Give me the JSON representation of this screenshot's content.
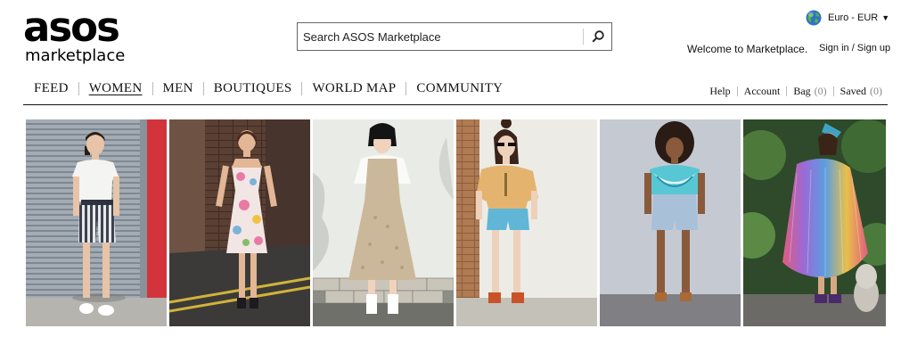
{
  "brand": {
    "logo_main": "asos",
    "logo_sub": "marketplace"
  },
  "search": {
    "placeholder": "Search ASOS Marketplace"
  },
  "currency": {
    "label": "Euro - EUR"
  },
  "welcome_text": "Welcome to Marketplace.",
  "signin_label": "Sign in / Sign up",
  "nav": {
    "items": [
      {
        "label": "FEED",
        "active": false
      },
      {
        "label": "WOMEN",
        "active": true
      },
      {
        "label": "MEN",
        "active": false
      },
      {
        "label": "BOUTIQUES",
        "active": false
      },
      {
        "label": "WORLD MAP",
        "active": false
      },
      {
        "label": "COMMUNITY",
        "active": false
      }
    ]
  },
  "utility": {
    "help": "Help",
    "account": "Account",
    "bag": "Bag",
    "bag_count": "(0)",
    "saved": "Saved",
    "saved_count": "(0)"
  },
  "gallery": {
    "photos": [
      {
        "subject": "model-shutter-striped-shorts"
      },
      {
        "subject": "model-floral-dress-alley"
      },
      {
        "subject": "model-beige-pinafore-wall"
      },
      {
        "subject": "model-denim-shorts-brick"
      },
      {
        "subject": "model-tiedye-top-grey-wall"
      },
      {
        "subject": "model-rainbow-dress-garden"
      }
    ]
  },
  "colors": {
    "text": "#111111",
    "divider": "#bbbbbb",
    "count": "#888888"
  }
}
